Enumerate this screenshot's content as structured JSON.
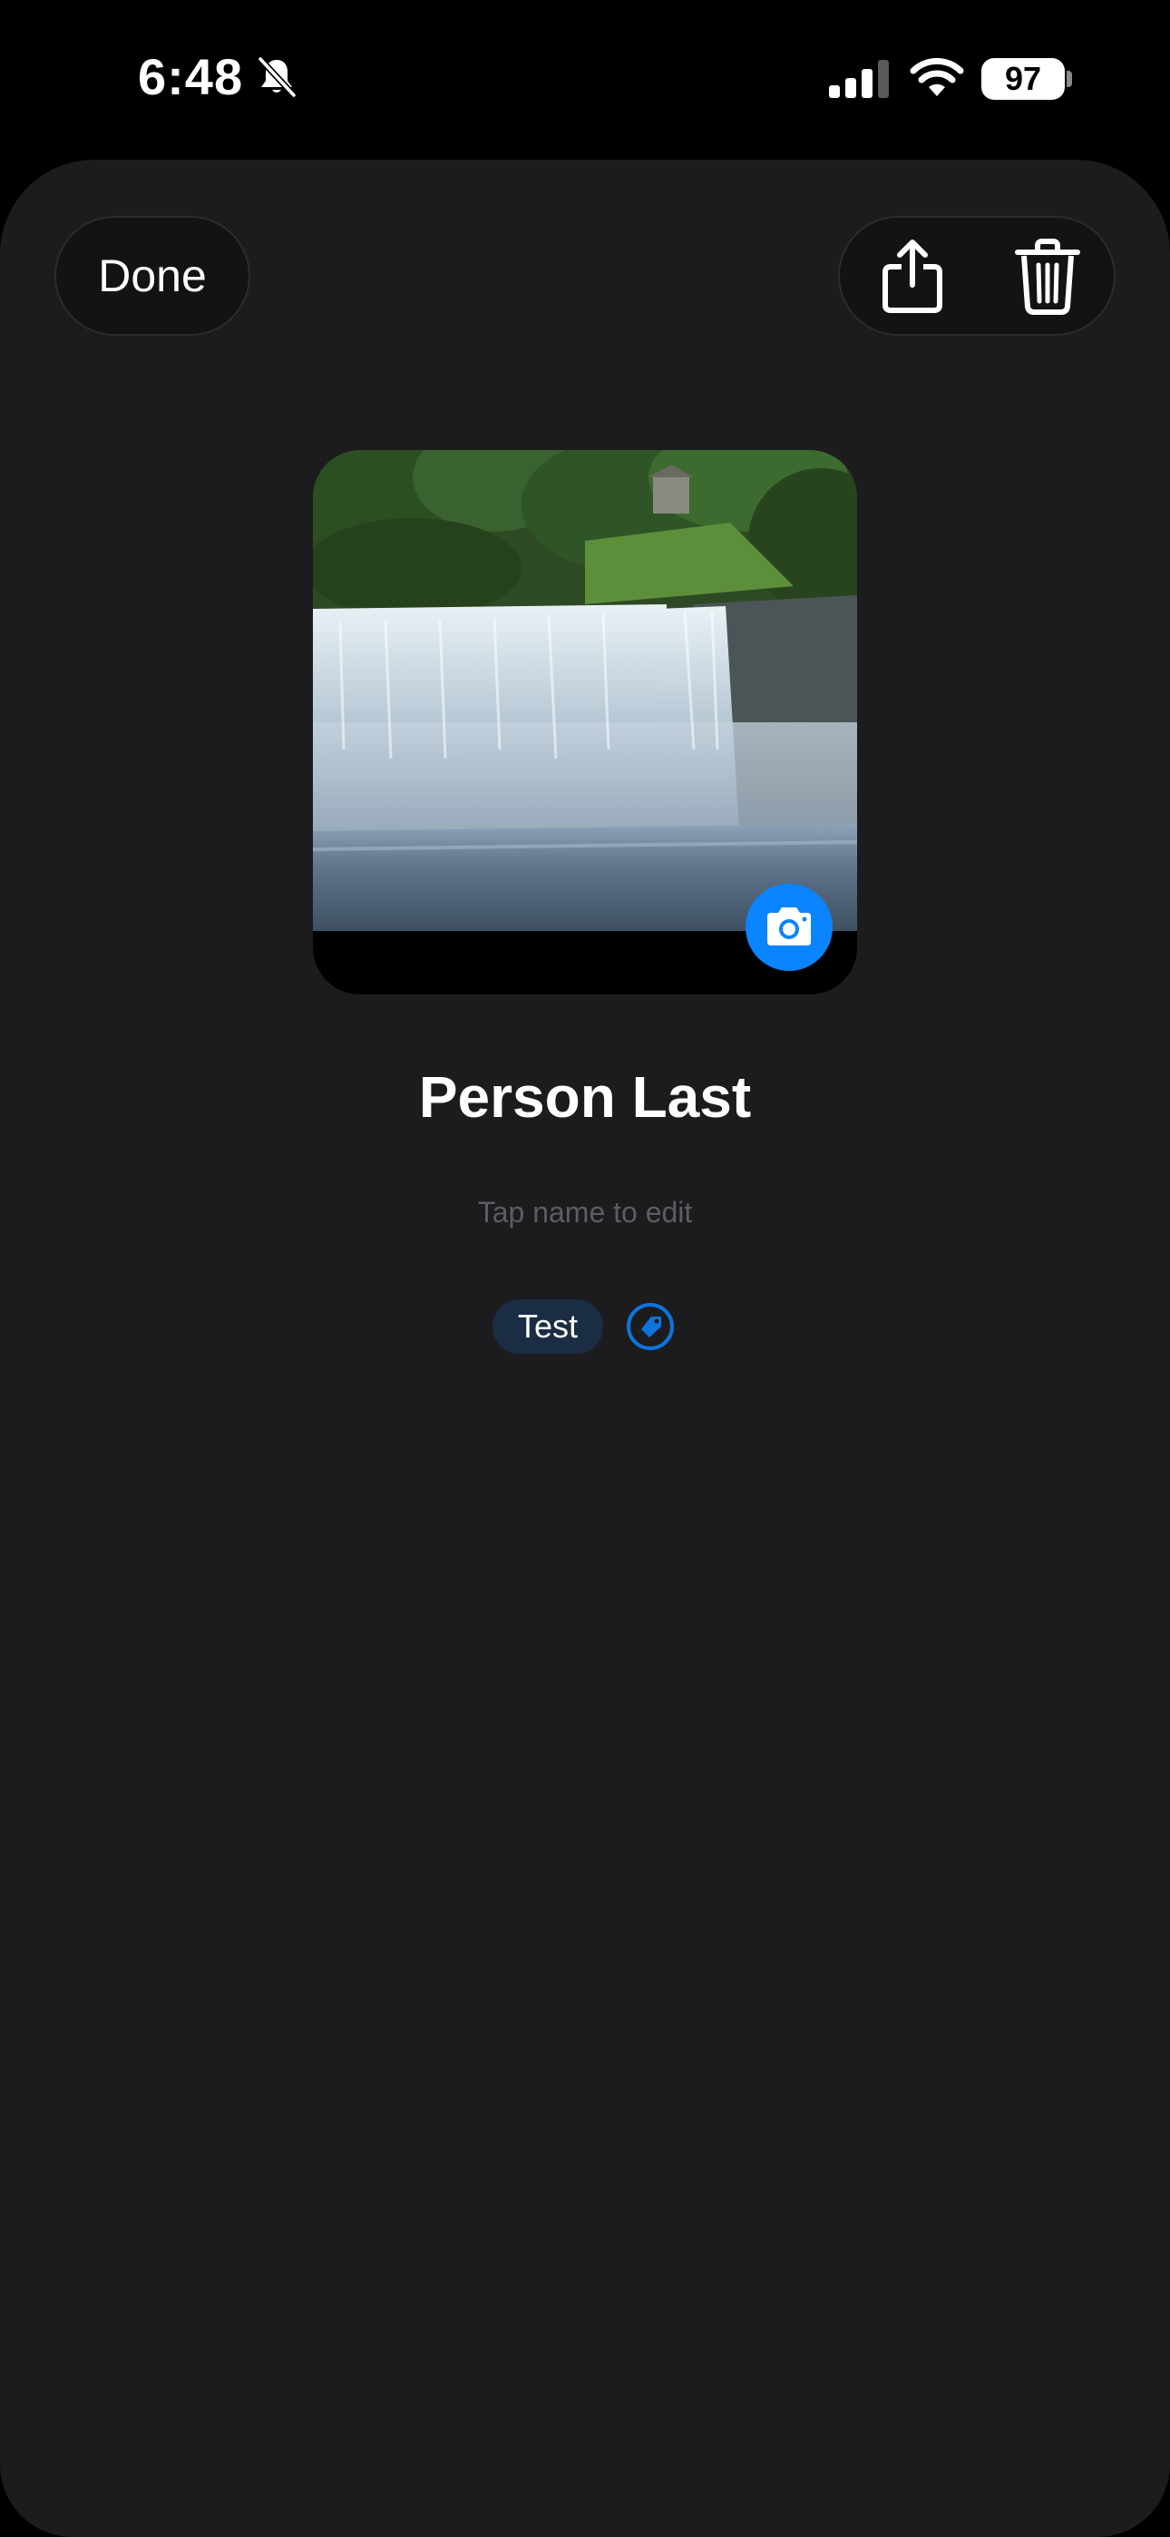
{
  "status_bar": {
    "time": "6:48",
    "battery": "97",
    "icons": [
      "bell-slash-icon",
      "cellular-signal-icon",
      "wifi-icon",
      "battery-icon"
    ]
  },
  "toolbar": {
    "done_label": "Done",
    "share_icon": "share-icon",
    "delete_icon": "trash-icon"
  },
  "photo": {
    "description_icon": "camera-icon",
    "camera_button_color": "#0a84ff"
  },
  "person": {
    "name": "Person Last",
    "edit_hint": "Tap name to edit"
  },
  "tags": {
    "items": [
      "Test"
    ],
    "add_icon": "tag-icon",
    "chip_color": "#1b2d44",
    "accent_color": "#0a84ff"
  },
  "colors": {
    "background": "#000000",
    "sheet": "#1c1c1e"
  }
}
